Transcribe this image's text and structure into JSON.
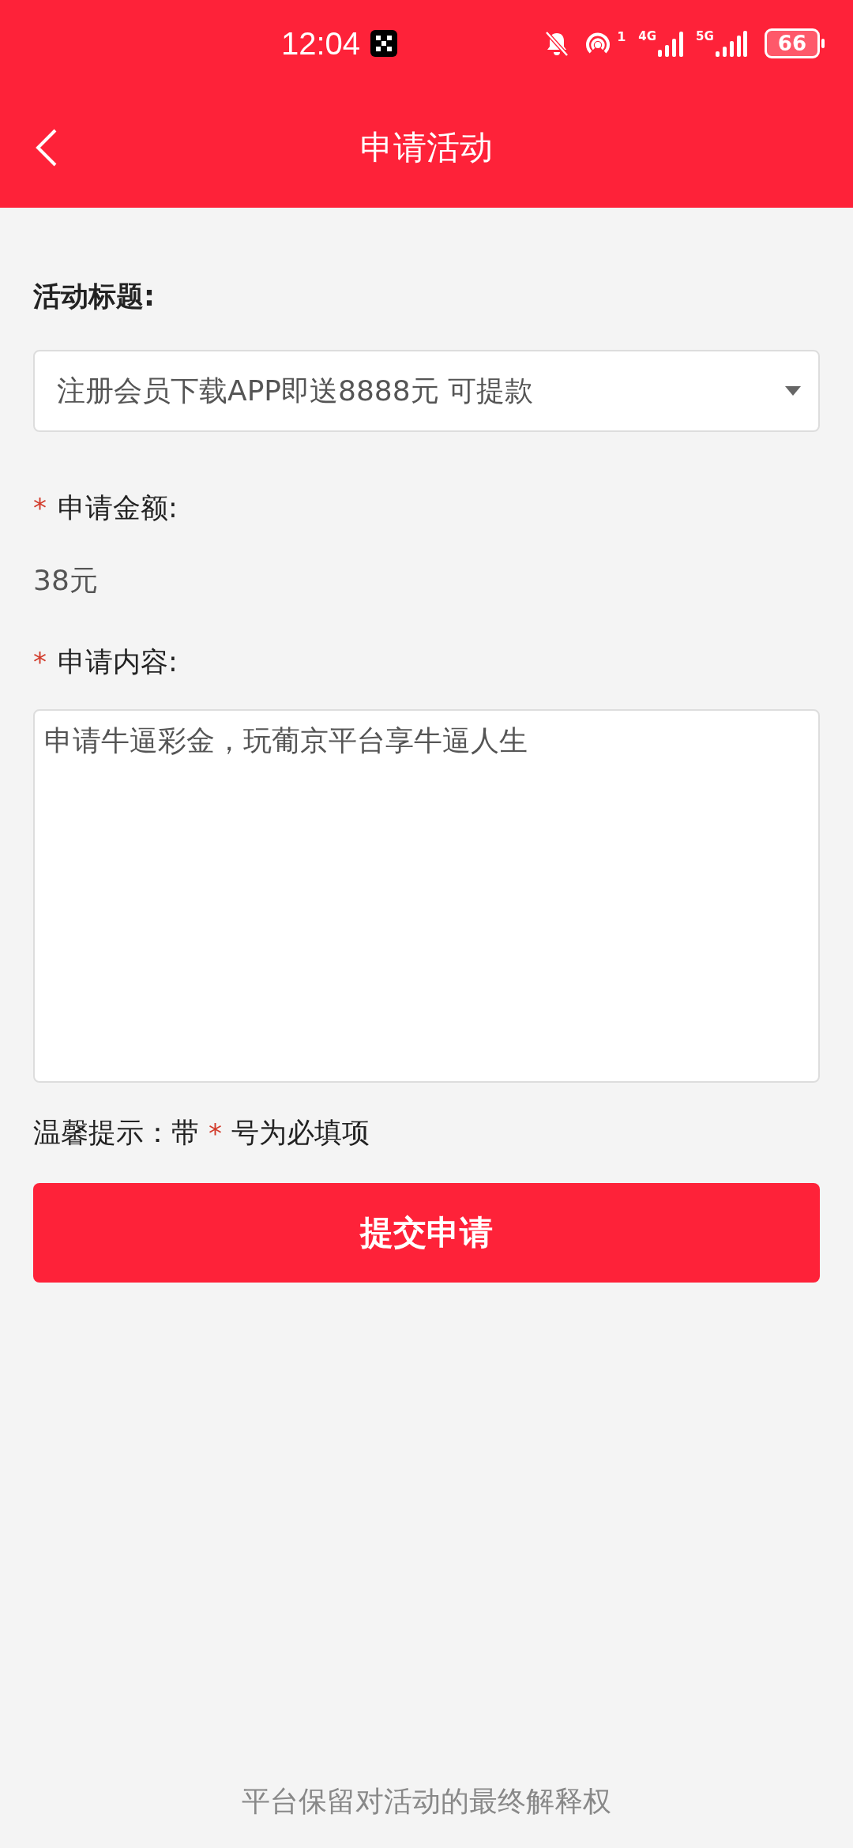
{
  "status_bar": {
    "time": "12:04",
    "hotspot_count": "1",
    "network_1": "4G",
    "network_2": "5G",
    "battery": "66"
  },
  "header": {
    "title": "申请活动"
  },
  "form": {
    "fields": [
      {
        "kind": "select",
        "label": "活动标题:",
        "required": false,
        "value": "注册会员下载APP即送8888元 可提款"
      },
      {
        "kind": "static",
        "label": "申请金额:",
        "required": true,
        "value": "38元"
      },
      {
        "kind": "textarea",
        "label": "申请内容:",
        "required": true,
        "value": "申请牛逼彩金，玩葡京平台享牛逼人生"
      }
    ],
    "hint": {
      "prefix": "温馨提示：带",
      "star": "*",
      "suffix": "号为必填项"
    },
    "required_mark": "*",
    "submit": "提交申请"
  },
  "footer": "平台保留对活动的最终解释权"
}
